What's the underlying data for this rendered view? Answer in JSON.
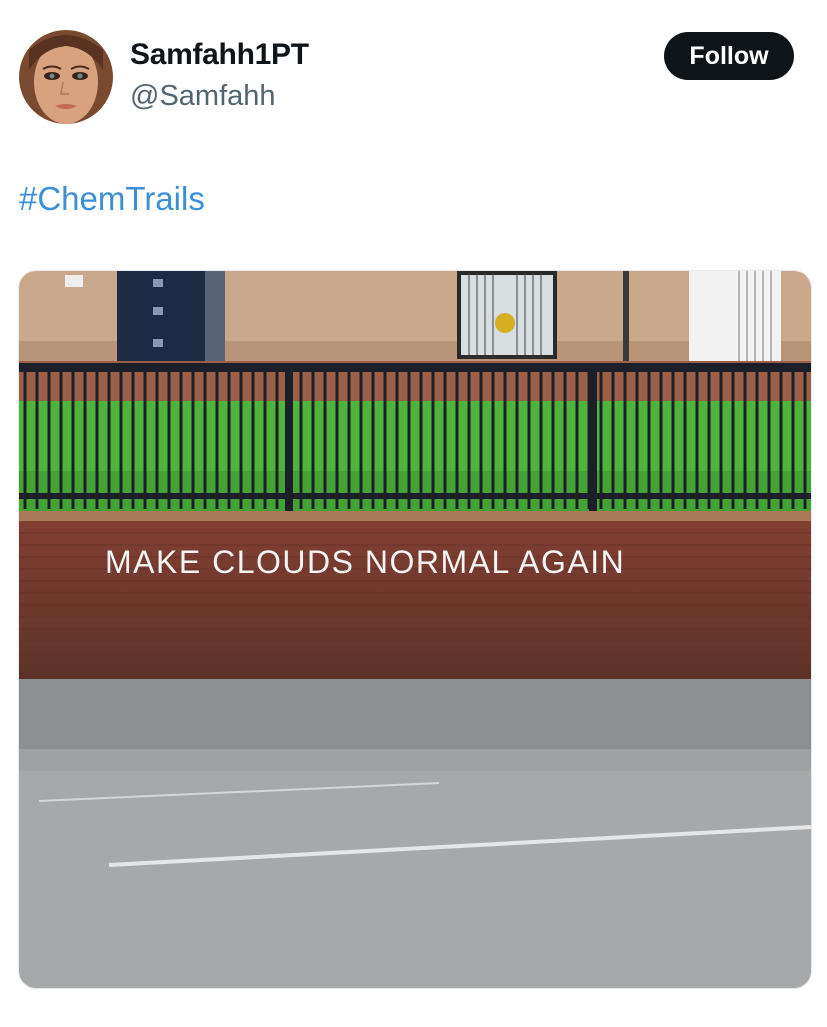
{
  "author": {
    "display_name": "Samfahh1PT",
    "handle": "@Samfahh",
    "avatar_icon": "profile-photo"
  },
  "follow_button": {
    "label": "Follow"
  },
  "tweet": {
    "hashtag": "#ChemTrails"
  },
  "media": {
    "graffiti_text": "MAKE CLOUDS NORMAL AGAIN"
  },
  "colors": {
    "follow_bg": "#0f1419",
    "hashtag": "#3b8fd8",
    "handle": "#536471"
  }
}
